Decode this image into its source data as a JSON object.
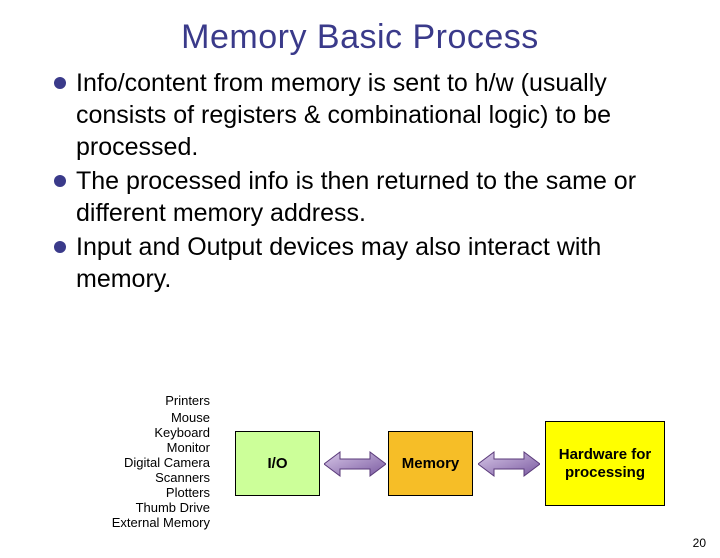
{
  "title": "Memory Basic Process",
  "bullets": [
    "Info/content from memory is sent to h/w (usually consists of registers & combinational logic) to be processed.",
    "The processed info is then returned to the same or different memory address.",
    "Input and Output devices may also interact with memory."
  ],
  "io_devices": {
    "first": "Printers",
    "rest": [
      "Mouse",
      "Keyboard",
      "Monitor",
      "Digital Camera",
      "Scanners",
      "Plotters",
      "Thumb Drive",
      "External Memory"
    ]
  },
  "boxes": {
    "io": "I/O",
    "memory": "Memory",
    "hardware": "Hardware for processing"
  },
  "page_number": "20"
}
